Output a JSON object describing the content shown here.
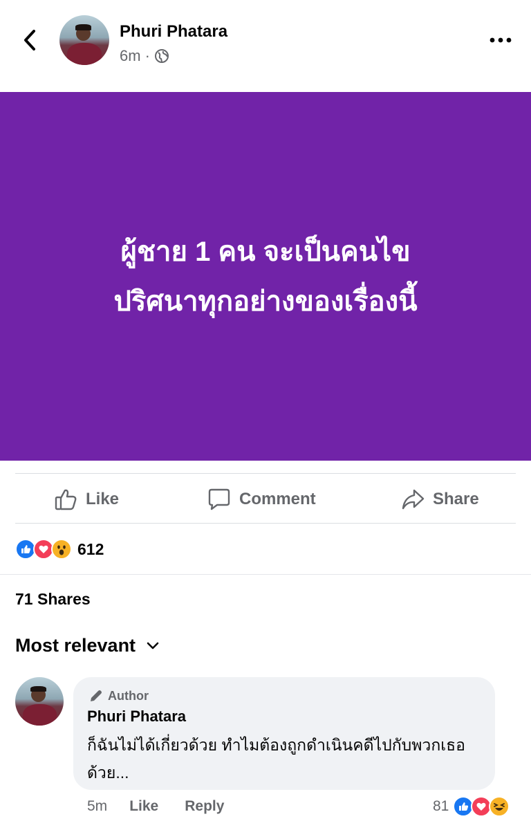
{
  "header": {
    "back_icon": "chevron-left-icon",
    "author_name": "Phuri Phatara",
    "time": "6m",
    "separator": "·",
    "privacy_icon": "globe-icon",
    "more_icon": "more-horizontal-icon"
  },
  "post": {
    "background_color": "#7123a8",
    "text_line_1": "ผู้ชาย 1 คน จะเป็นคนไข",
    "text_line_2": "ปริศนาทุกอย่างของเรื่องนี้"
  },
  "actions": {
    "like_label": "Like",
    "comment_label": "Comment",
    "share_label": "Share"
  },
  "reactions": {
    "icons": [
      "like-reaction-icon",
      "love-reaction-icon",
      "wow-reaction-icon"
    ],
    "count": "612"
  },
  "shares": "71 Shares",
  "sort": {
    "label": "Most relevant",
    "icon": "chevron-down-icon"
  },
  "comment": {
    "badge_icon": "pen-icon",
    "badge": "Author",
    "author": "Phuri Phatara",
    "text": "ก็ฉันไม่ได้เกี่ยวด้วย ทำไมต้องถูกดำเนินคดีไปกับพวกเธอด้วย...",
    "time": "5m",
    "like_label": "Like",
    "reply_label": "Reply",
    "reaction_count": "81",
    "reaction_icons": [
      "like-reaction-icon",
      "love-reaction-icon",
      "haha-reaction-icon"
    ]
  },
  "colors": {
    "accent_blue": "#1877f2",
    "love_red": "#f33e58",
    "wow_yellow": "#f7b125",
    "secondary_text": "#65676b"
  }
}
